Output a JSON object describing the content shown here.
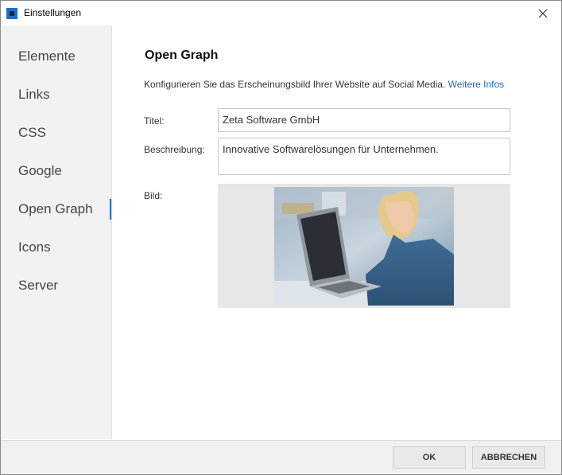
{
  "window": {
    "title": "Einstellungen"
  },
  "sidebar": {
    "items": [
      {
        "label": "Elemente"
      },
      {
        "label": "Links"
      },
      {
        "label": "CSS"
      },
      {
        "label": "Google"
      },
      {
        "label": "Open Graph"
      },
      {
        "label": "Icons"
      },
      {
        "label": "Server"
      }
    ],
    "active": "Open Graph"
  },
  "main": {
    "title": "Open Graph",
    "intro_text": "Konfigurieren Sie das Erscheinungsbild Ihrer Website auf Social Media.",
    "intro_link": "Weitere Infos",
    "fields": {
      "title_label": "Titel:",
      "title_value": "Zeta Software GmbH",
      "description_label": "Beschreibung:",
      "description_value": "Innovative Softwarelösungen für Unternehmen.",
      "image_label": "Bild:"
    }
  },
  "footer": {
    "ok_label": "OK",
    "cancel_label": "ABBRECHEN"
  },
  "colors": {
    "accent": "#2b6cb5",
    "link": "#1e6bb8",
    "sidebar_bg": "#f2f2f2"
  }
}
